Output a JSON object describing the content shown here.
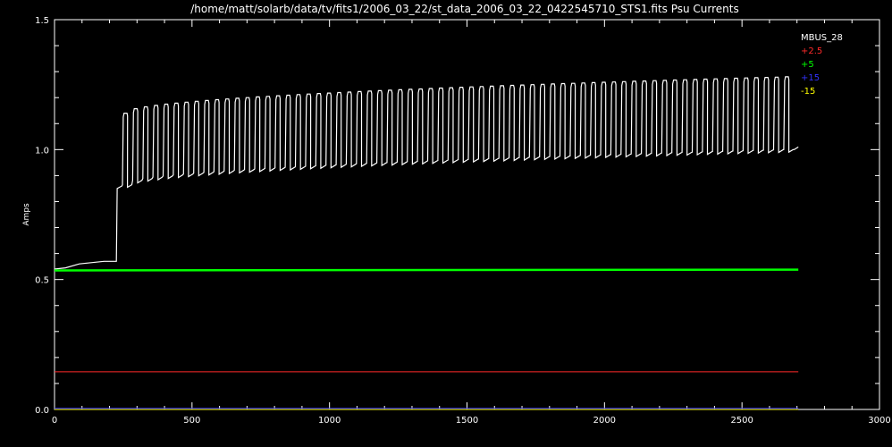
{
  "chart_data": {
    "type": "line",
    "title": "/home/matt/solarb/data/tv/fits1/2006_03_22/st_data_2006_03_22_0422545710_STS1.fits  Psu Currents",
    "xlabel": "",
    "ylabel": "Amps",
    "xlim": [
      0,
      3000
    ],
    "ylim": [
      0,
      1.5
    ],
    "x_ticks": [
      0,
      500,
      1000,
      1500,
      2000,
      2500,
      3000
    ],
    "x_tick_labels": [
      "0",
      "500",
      "1000",
      "1500",
      "2000",
      "2500",
      "3000"
    ],
    "y_ticks": [
      0.0,
      0.5,
      1.0,
      1.5
    ],
    "y_tick_labels": [
      "0.0",
      "0.5",
      "1.0",
      "1.5"
    ],
    "grid": false,
    "legend_position": "top-right",
    "background": "#000000",
    "axis_color": "#ffffff",
    "series": [
      {
        "name": "MBUS_28",
        "color": "#ffffff",
        "pattern": {
          "initial": [
            [
              0,
              0.54
            ],
            [
              40,
              0.545
            ],
            [
              90,
              0.56
            ],
            [
              180,
              0.57
            ],
            [
              225,
              0.57
            ],
            [
              228,
              0.85
            ],
            [
              245,
              0.86
            ]
          ],
          "square_wave_start": 245,
          "period": 37,
          "high_start": 1.14,
          "high_end": 1.28,
          "low_start": 0.865,
          "low_end": 1.0,
          "last_x": 2700,
          "final": [
            [
              2690,
              1.0
            ],
            [
              2705,
              1.01
            ]
          ]
        }
      },
      {
        "name": "+2.5",
        "color": "#ff2a2a",
        "points": [
          [
            0,
            0.145
          ],
          [
            2705,
            0.145
          ]
        ]
      },
      {
        "name": "+5",
        "color": "#00ff00",
        "points": [
          [
            0,
            0.535
          ],
          [
            2705,
            0.538
          ]
        ]
      },
      {
        "name": "+15",
        "color": "#3333ff",
        "points": [
          [
            0,
            0.004
          ],
          [
            2705,
            0.004
          ]
        ]
      },
      {
        "name": "-15",
        "color": "#ffff00",
        "points": [
          [
            0,
            0.0
          ],
          [
            2705,
            0.0
          ]
        ]
      }
    ]
  }
}
